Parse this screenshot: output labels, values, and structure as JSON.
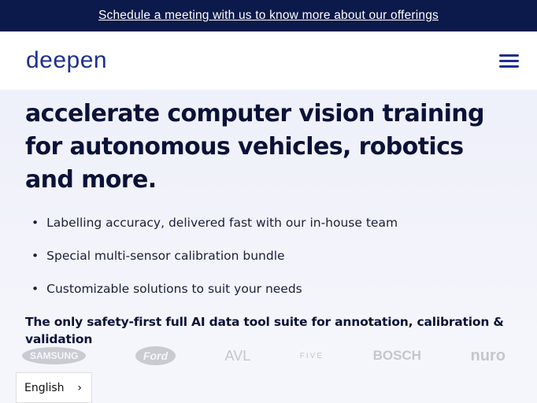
{
  "banner": {
    "link": "Schedule a meeting with us to know more about our offerings"
  },
  "nav": {
    "logo": "deepen",
    "menu_icon": "hamburger-icon"
  },
  "hero": {
    "headline": "accelerate computer vision training for autonomous vehicles, robotics and more.",
    "bullets": [
      "Labelling accuracy, delivered fast with our in-house team",
      "Special multi-sensor calibration bundle",
      "Customizable solutions to suit your needs"
    ],
    "tagline": "The only safety-first full AI data tool suite for annotation, calibration & validation"
  },
  "logos": [
    "SAMSUNG",
    "Ford",
    "AVL",
    "FIVE",
    "BOSCH",
    "nuro"
  ],
  "language": {
    "label": "English",
    "icon": "chevron-right-icon"
  }
}
